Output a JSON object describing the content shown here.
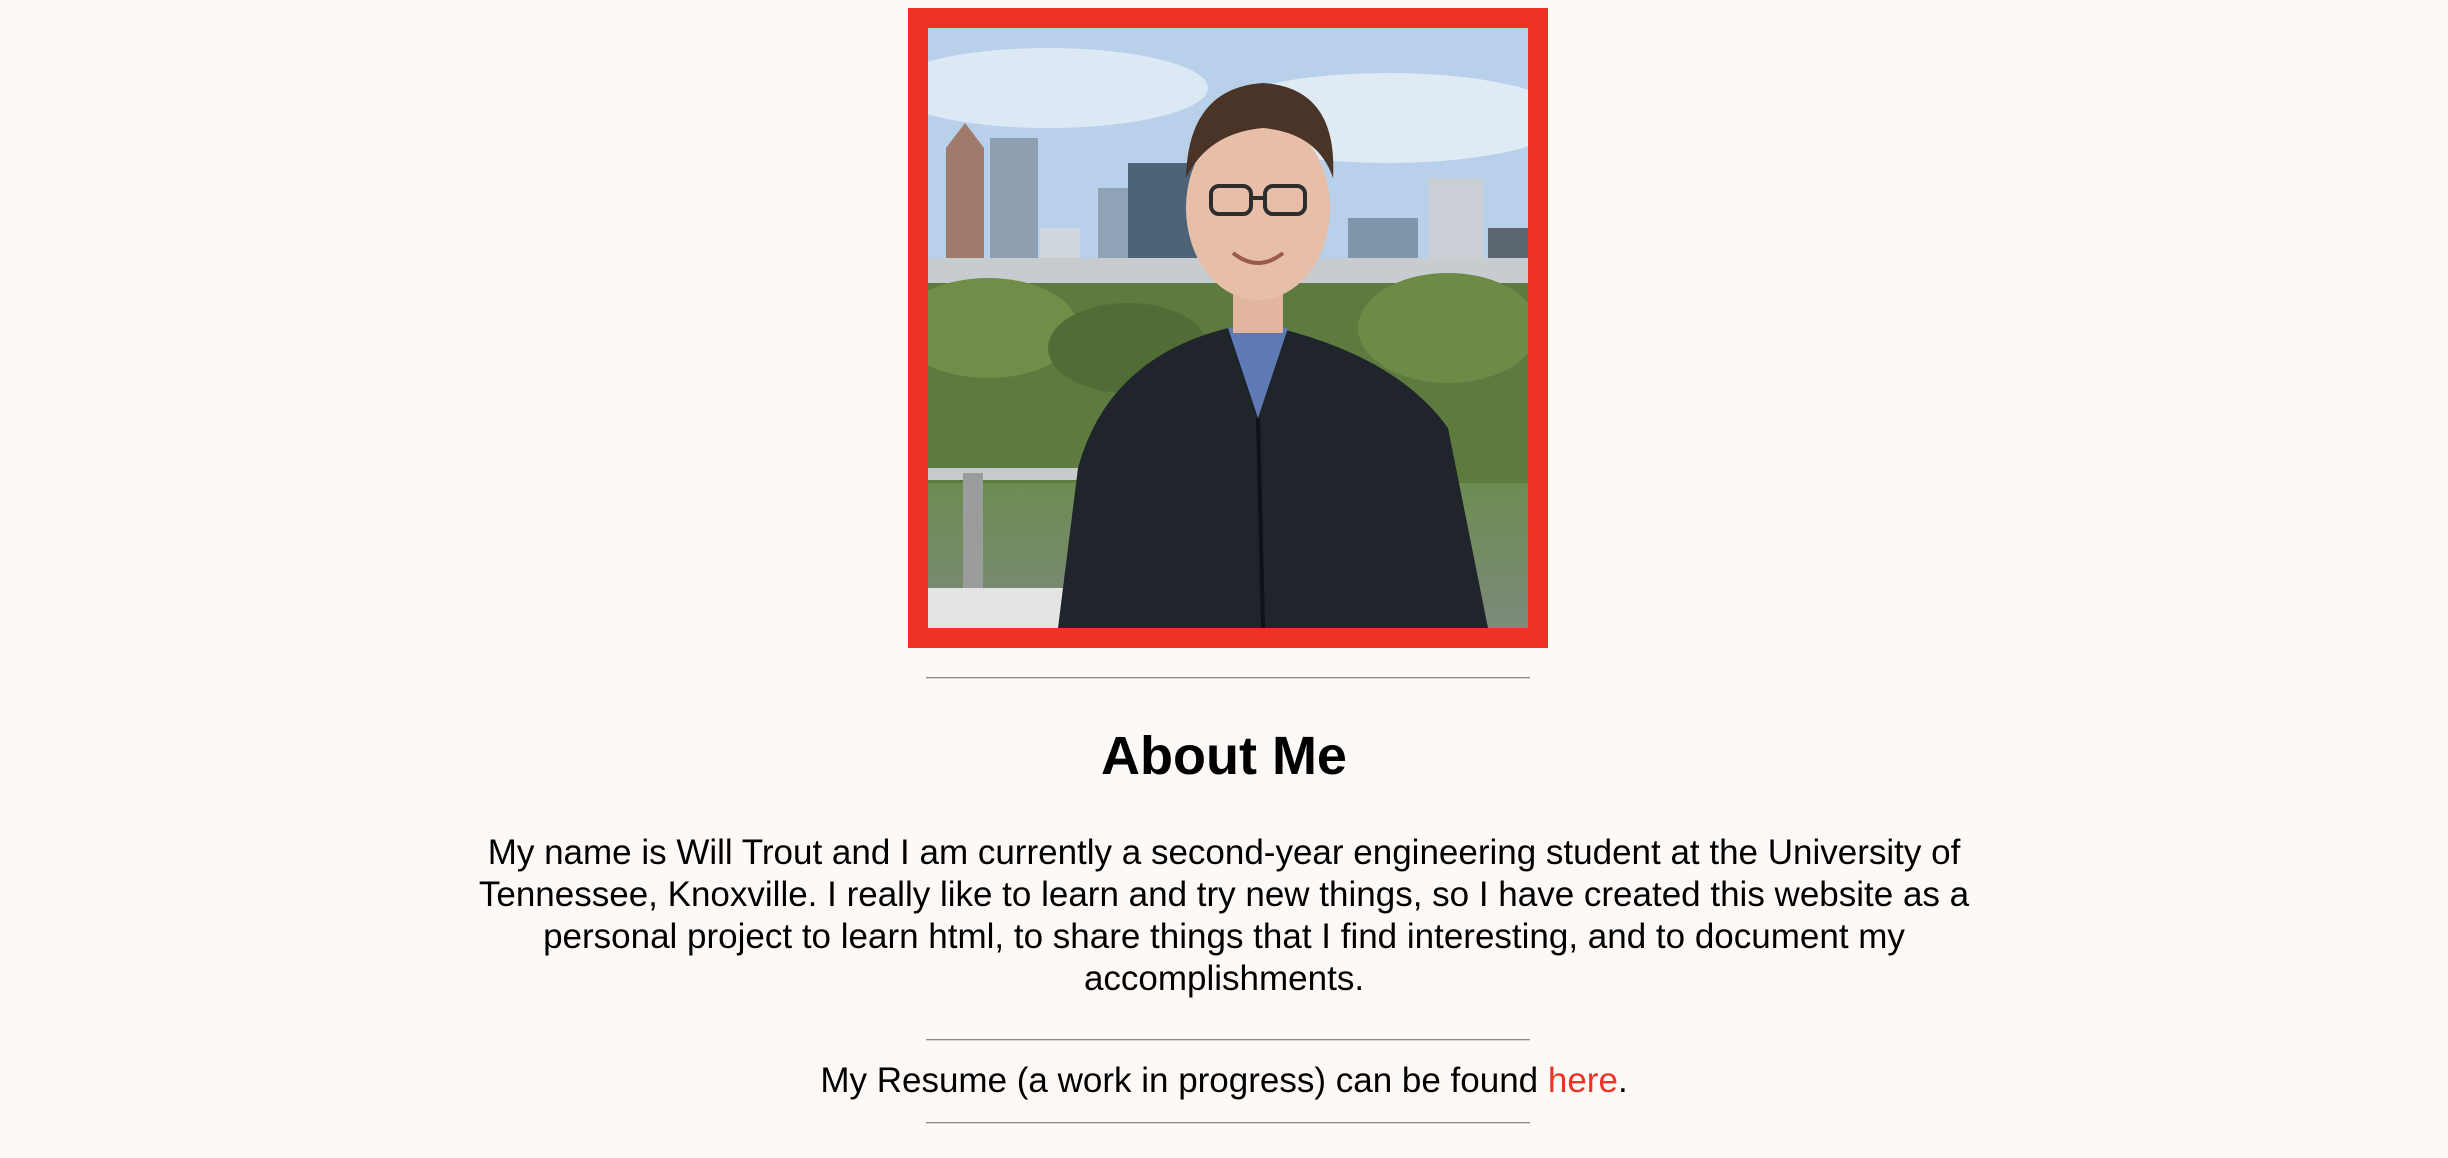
{
  "profile_photo": {
    "alt": "Will Trout standing on a rooftop with a city skyline behind him",
    "frame_color": "#ee3224"
  },
  "about": {
    "heading": "About Me",
    "bio": "My name is Will Trout and I am currently a second-year engineering student at the University of Tennessee, Knoxville. I really like to learn and try new things, so I have created this website as a personal project to learn html, to share things that I find interesting, and to document my accomplishments."
  },
  "resume": {
    "prefix": "My Resume (a work in progress) can be found ",
    "link_label": "here",
    "suffix": "."
  },
  "colors": {
    "background": "#fcf9f7",
    "accent": "#ee3224",
    "text": "#000000"
  }
}
